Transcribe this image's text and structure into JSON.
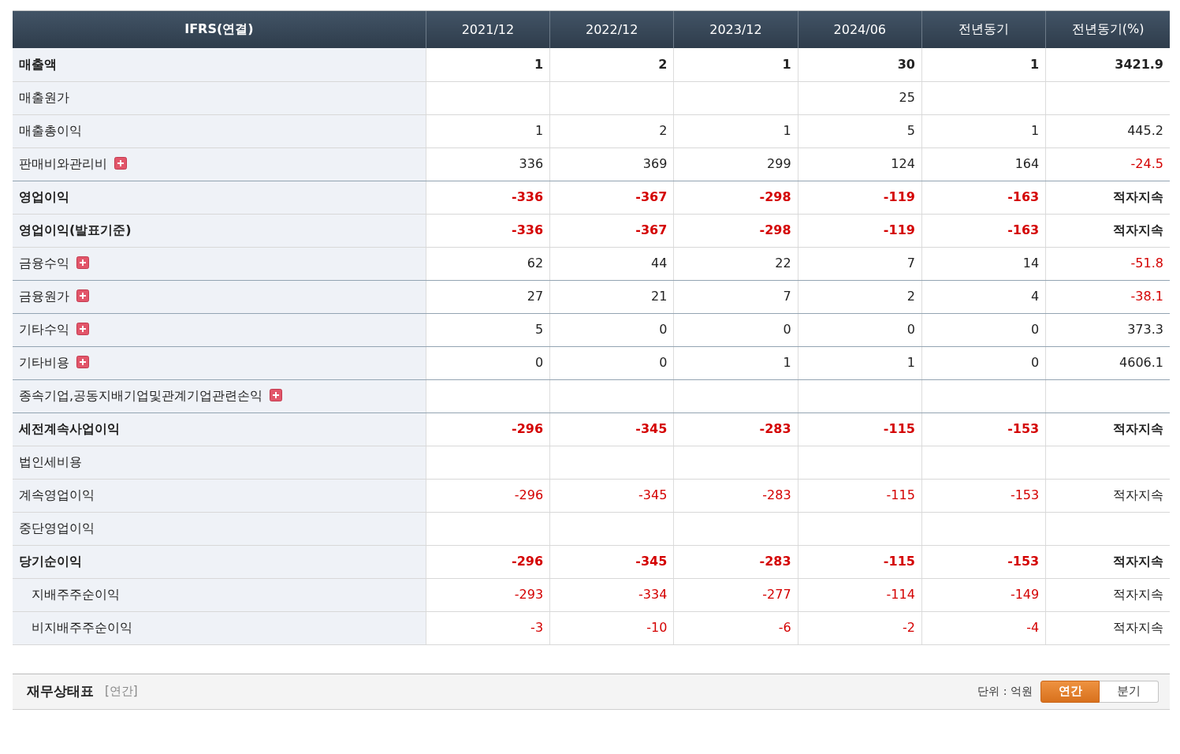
{
  "table": {
    "label_header": "IFRS(연결)",
    "columns": [
      "2021/12",
      "2022/12",
      "2023/12",
      "2024/06",
      "전년동기",
      "전년동기(%)"
    ],
    "rows": [
      {
        "label": "매출액",
        "bold": true,
        "expandable": false,
        "cells": [
          {
            "text": "1",
            "negative": false
          },
          {
            "text": "2",
            "negative": false
          },
          {
            "text": "1",
            "negative": false
          },
          {
            "text": "30",
            "negative": false
          },
          {
            "text": "1",
            "negative": false
          },
          {
            "text": "3421.9",
            "negative": false
          }
        ]
      },
      {
        "label": "매출원가",
        "bold": false,
        "expandable": false,
        "cells": [
          null,
          null,
          null,
          {
            "text": "25",
            "negative": false
          },
          null,
          null
        ]
      },
      {
        "label": "매출총이익",
        "bold": false,
        "expandable": false,
        "cells": [
          {
            "text": "1",
            "negative": false
          },
          {
            "text": "2",
            "negative": false
          },
          {
            "text": "1",
            "negative": false
          },
          {
            "text": "5",
            "negative": false
          },
          {
            "text": "1",
            "negative": false
          },
          {
            "text": "445.2",
            "negative": false
          }
        ]
      },
      {
        "label": "판매비와관리비",
        "bold": false,
        "expandable": true,
        "cells": [
          {
            "text": "336",
            "negative": false
          },
          {
            "text": "369",
            "negative": false
          },
          {
            "text": "299",
            "negative": false
          },
          {
            "text": "124",
            "negative": false
          },
          {
            "text": "164",
            "negative": false
          },
          {
            "text": "-24.5",
            "negative": true
          }
        ]
      },
      {
        "label": "영업이익",
        "bold": true,
        "expandable": false,
        "cells": [
          {
            "text": "-336",
            "negative": true
          },
          {
            "text": "-367",
            "negative": true
          },
          {
            "text": "-298",
            "negative": true
          },
          {
            "text": "-119",
            "negative": true
          },
          {
            "text": "-163",
            "negative": true
          },
          {
            "text": "적자지속",
            "negative": false
          }
        ]
      },
      {
        "label": "영업이익(발표기준)",
        "bold": true,
        "expandable": false,
        "cells": [
          {
            "text": "-336",
            "negative": true
          },
          {
            "text": "-367",
            "negative": true
          },
          {
            "text": "-298",
            "negative": true
          },
          {
            "text": "-119",
            "negative": true
          },
          {
            "text": "-163",
            "negative": true
          },
          {
            "text": "적자지속",
            "negative": false
          }
        ]
      },
      {
        "label": "금융수익",
        "bold": false,
        "expandable": true,
        "cells": [
          {
            "text": "62",
            "negative": false
          },
          {
            "text": "44",
            "negative": false
          },
          {
            "text": "22",
            "negative": false
          },
          {
            "text": "7",
            "negative": false
          },
          {
            "text": "14",
            "negative": false
          },
          {
            "text": "-51.8",
            "negative": true
          }
        ]
      },
      {
        "label": "금융원가",
        "bold": false,
        "expandable": true,
        "cells": [
          {
            "text": "27",
            "negative": false
          },
          {
            "text": "21",
            "negative": false
          },
          {
            "text": "7",
            "negative": false
          },
          {
            "text": "2",
            "negative": false
          },
          {
            "text": "4",
            "negative": false
          },
          {
            "text": "-38.1",
            "negative": true
          }
        ]
      },
      {
        "label": "기타수익",
        "bold": false,
        "expandable": true,
        "cells": [
          {
            "text": "5",
            "negative": false
          },
          {
            "text": "0",
            "negative": false
          },
          {
            "text": "0",
            "negative": false
          },
          {
            "text": "0",
            "negative": false
          },
          {
            "text": "0",
            "negative": false
          },
          {
            "text": "373.3",
            "negative": false
          }
        ]
      },
      {
        "label": "기타비용",
        "bold": false,
        "expandable": true,
        "cells": [
          {
            "text": "0",
            "negative": false
          },
          {
            "text": "0",
            "negative": false
          },
          {
            "text": "1",
            "negative": false
          },
          {
            "text": "1",
            "negative": false
          },
          {
            "text": "0",
            "negative": false
          },
          {
            "text": "4606.1",
            "negative": false
          }
        ]
      },
      {
        "label": "종속기업,공동지배기업및관계기업관련손익",
        "bold": false,
        "expandable": true,
        "cells": [
          null,
          null,
          null,
          null,
          null,
          null
        ]
      },
      {
        "label": "세전계속사업이익",
        "bold": true,
        "expandable": false,
        "cells": [
          {
            "text": "-296",
            "negative": true
          },
          {
            "text": "-345",
            "negative": true
          },
          {
            "text": "-283",
            "negative": true
          },
          {
            "text": "-115",
            "negative": true
          },
          {
            "text": "-153",
            "negative": true
          },
          {
            "text": "적자지속",
            "negative": false
          }
        ]
      },
      {
        "label": "법인세비용",
        "bold": false,
        "expandable": false,
        "cells": [
          null,
          null,
          null,
          null,
          null,
          null
        ]
      },
      {
        "label": "계속영업이익",
        "bold": false,
        "expandable": false,
        "cells": [
          {
            "text": "-296",
            "negative": true
          },
          {
            "text": "-345",
            "negative": true
          },
          {
            "text": "-283",
            "negative": true
          },
          {
            "text": "-115",
            "negative": true
          },
          {
            "text": "-153",
            "negative": true
          },
          {
            "text": "적자지속",
            "negative": false
          }
        ]
      },
      {
        "label": "중단영업이익",
        "bold": false,
        "expandable": false,
        "cells": [
          null,
          null,
          null,
          null,
          null,
          null
        ]
      },
      {
        "label": "당기순이익",
        "bold": true,
        "expandable": false,
        "cells": [
          {
            "text": "-296",
            "negative": true
          },
          {
            "text": "-345",
            "negative": true
          },
          {
            "text": "-283",
            "negative": true
          },
          {
            "text": "-115",
            "negative": true
          },
          {
            "text": "-153",
            "negative": true
          },
          {
            "text": "적자지속",
            "negative": false
          }
        ],
        "children": [
          {
            "label": "지배주주순이익",
            "bold": false,
            "expandable": false,
            "cells": [
              {
                "text": "-293",
                "negative": true
              },
              {
                "text": "-334",
                "negative": true
              },
              {
                "text": "-277",
                "negative": true
              },
              {
                "text": "-114",
                "negative": true
              },
              {
                "text": "-149",
                "negative": true
              },
              {
                "text": "적자지속",
                "negative": false
              }
            ]
          },
          {
            "label": "비지배주주순이익",
            "bold": false,
            "expandable": false,
            "cells": [
              {
                "text": "-3",
                "negative": true
              },
              {
                "text": "-10",
                "negative": true
              },
              {
                "text": "-6",
                "negative": true
              },
              {
                "text": "-2",
                "negative": true
              },
              {
                "text": "-4",
                "negative": true
              },
              {
                "text": "적자지속",
                "negative": false
              }
            ]
          }
        ]
      }
    ]
  },
  "next_section": {
    "title": "재무상태표",
    "period": "[연간]",
    "unit": "단위 : 억원",
    "toggles": [
      {
        "label": "연간",
        "selected": true
      },
      {
        "label": "분기",
        "selected": false
      }
    ]
  }
}
